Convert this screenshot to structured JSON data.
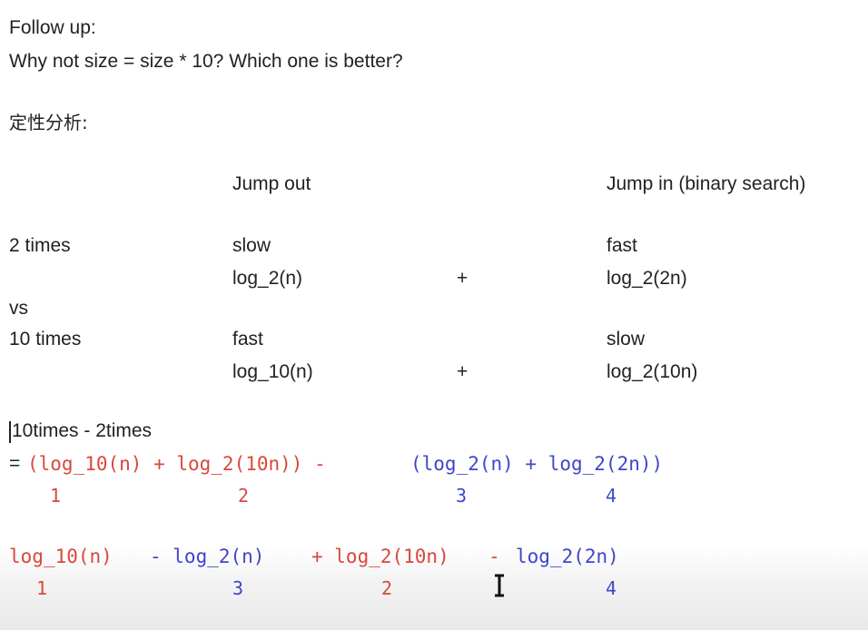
{
  "header": {
    "follow_up": "Follow up:",
    "question": "Why not size = size * 10? Which one is better?",
    "section": "定性分析:"
  },
  "table": {
    "col_jump_out": "Jump out",
    "col_jump_in": "Jump in (binary search)",
    "row1": {
      "label": "2 times",
      "out_speed": "slow",
      "out_formula": "log_2(n)",
      "plus": "+",
      "in_speed": "fast",
      "in_formula": "log_2(2n)"
    },
    "vs": "vs",
    "row2": {
      "label": "10 times",
      "out_speed": "fast",
      "out_formula": "log_10(n)",
      "plus": "+",
      "in_speed": "slow",
      "in_formula": "log_2(10n)"
    }
  },
  "derivation": {
    "line1": "10times - 2times",
    "eq": "=",
    "red_part": "(log_10(n) + log_2(10n)) -",
    "blue_part": "(log_2(n) + log_2(2n))",
    "labels1": [
      "1",
      "2",
      "3",
      "4"
    ],
    "line3_a": "log_10(n)",
    "line3_b": "- log_2(n)",
    "line3_c": "+ log_2(10n)",
    "line3_d": "-",
    "line3_e": "log_2(2n)",
    "labels2": [
      "1",
      "3",
      "2",
      "4"
    ]
  },
  "colors": {
    "red": "#d9483b",
    "blue": "#3d46c9",
    "text": "#222222"
  }
}
